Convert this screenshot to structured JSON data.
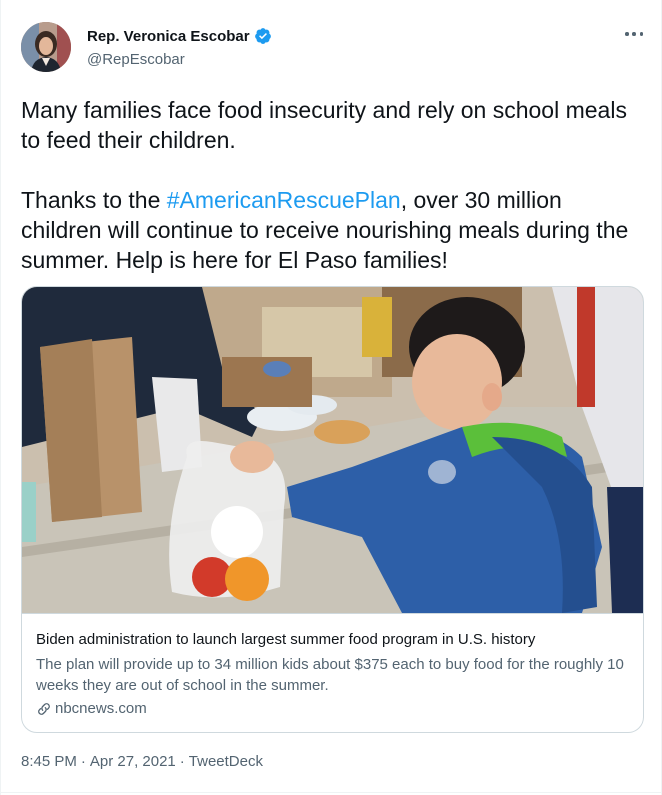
{
  "author": {
    "display_name": "Rep. Veronica Escobar",
    "handle": "@RepEscobar",
    "verified_icon": "verified-badge-icon",
    "avatar_icon": "profile-photo"
  },
  "menu_icon": "more-options-icon",
  "tweet": {
    "line1": "Many families face food insecurity and rely on school meals to feed their children.",
    "para2_prefix": "Thanks to the ",
    "hashtag": "#AmericanRescuePlan",
    "para2_suffix": ", over 30 million children will continue to receive nourishing meals during the summer. Help is here for El Paso families!"
  },
  "card": {
    "title": "Biden administration to launch largest summer food program in U.S. history",
    "description": "The plan will provide up to 34 million kids about $375 each to buy food for the roughly 10 weeks they are out of school in the summer.",
    "domain": "nbcnews.com",
    "link_icon": "link-icon"
  },
  "meta": {
    "time": "8:45 PM",
    "separator1": "·",
    "date": "Apr 27, 2021",
    "separator2": "·",
    "source": "TweetDeck"
  },
  "colors": {
    "accent": "#1d9bf0",
    "secondary_text": "#536471",
    "primary_text": "#0f1419",
    "border": "#cfd9de"
  }
}
